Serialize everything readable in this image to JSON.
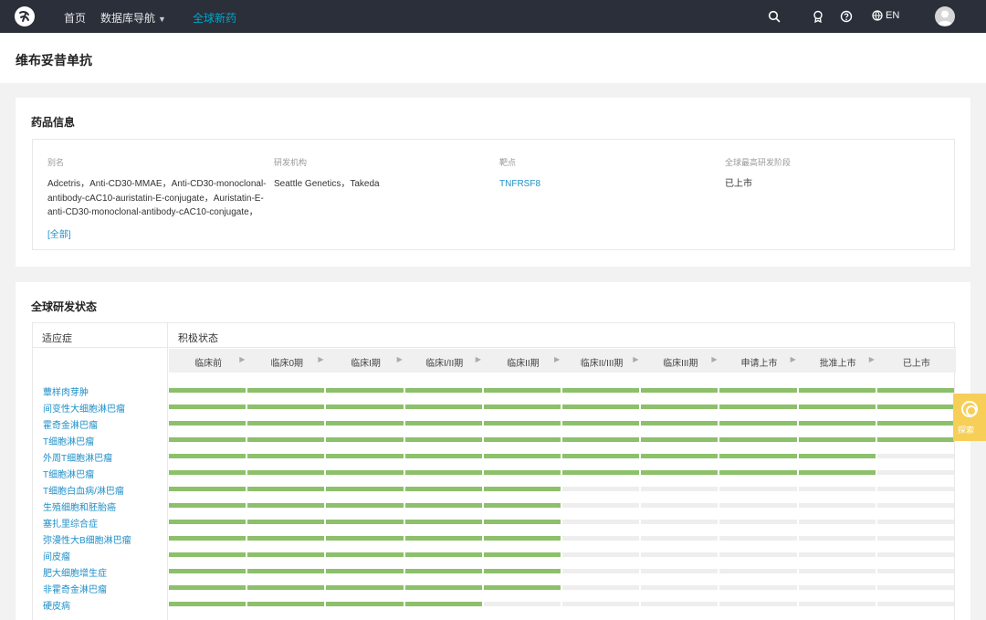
{
  "nav": {
    "items": [
      "首页",
      "数据库导航",
      "全球新药"
    ],
    "lang": "EN"
  },
  "page": {
    "title": "维布妥昔单抗"
  },
  "drug_info": {
    "title": "药品信息",
    "alias_label": "别名",
    "alias_lines": [
      "Adcetris，Anti-CD30-MMAE，Anti-CD30-monoclonal-",
      "antibody-cAC10-auristatin-E-conjugate，Auristatin-E-",
      "anti-CD30-monoclonal-antibody-cAC10-conjugate，"
    ],
    "alias_more": "[全部]",
    "org_label": "研发机构",
    "org_value": "Seattle Genetics，Takeda",
    "target_label": "靶点",
    "target_value": "TNFRSF8",
    "stage_label": "全球最高研发阶段",
    "stage_value": "已上市"
  },
  "status": {
    "title": "全球研发状态",
    "indication_header": "适应症",
    "active_header": "积极状态",
    "phases": [
      "临床前",
      "临床0期",
      "临床I期",
      "临床I/II期",
      "临床II期",
      "临床II/III期",
      "临床III期",
      "申请上市",
      "批准上市",
      "已上市"
    ],
    "indications": [
      {
        "name": "蕈样肉芽肿",
        "phases_completed": 10
      },
      {
        "name": "间变性大细胞淋巴瘤",
        "phases_completed": 10
      },
      {
        "name": "霍奇金淋巴瘤",
        "phases_completed": 10
      },
      {
        "name": "T细胞淋巴瘤",
        "phases_completed": 10
      },
      {
        "name": "外周T细胞淋巴瘤",
        "phases_completed": 9
      },
      {
        "name": "T细胞淋巴瘤",
        "phases_completed": 9
      },
      {
        "name": "T细胞白血病/淋巴瘤",
        "phases_completed": 5
      },
      {
        "name": "生殖细胞和胚胎癌",
        "phases_completed": 5
      },
      {
        "name": "塞扎里综合症",
        "phases_completed": 5
      },
      {
        "name": "弥漫性大B细胞淋巴瘤",
        "phases_completed": 5
      },
      {
        "name": "间皮瘤",
        "phases_completed": 5
      },
      {
        "name": "肥大细胞增生症",
        "phases_completed": 5
      },
      {
        "name": "非霍奇金淋巴瘤",
        "phases_completed": 5
      },
      {
        "name": "硬皮病",
        "phases_completed": 4
      }
    ]
  },
  "float_tab": {
    "label": "探索"
  },
  "colors": {
    "accent": "#00a6c8",
    "link": "#1f8fc7",
    "bar_active": "#8dc06a",
    "bar_empty": "#eeeeee",
    "nav_bg": "#2a2f3a",
    "float_tab": "#f7cf58"
  },
  "icons": [
    "logo-icon",
    "chevron-down-icon",
    "search-icon",
    "award-icon",
    "help-icon",
    "globe-icon",
    "avatar-icon",
    "chevron-right-icon",
    "target-icon"
  ]
}
